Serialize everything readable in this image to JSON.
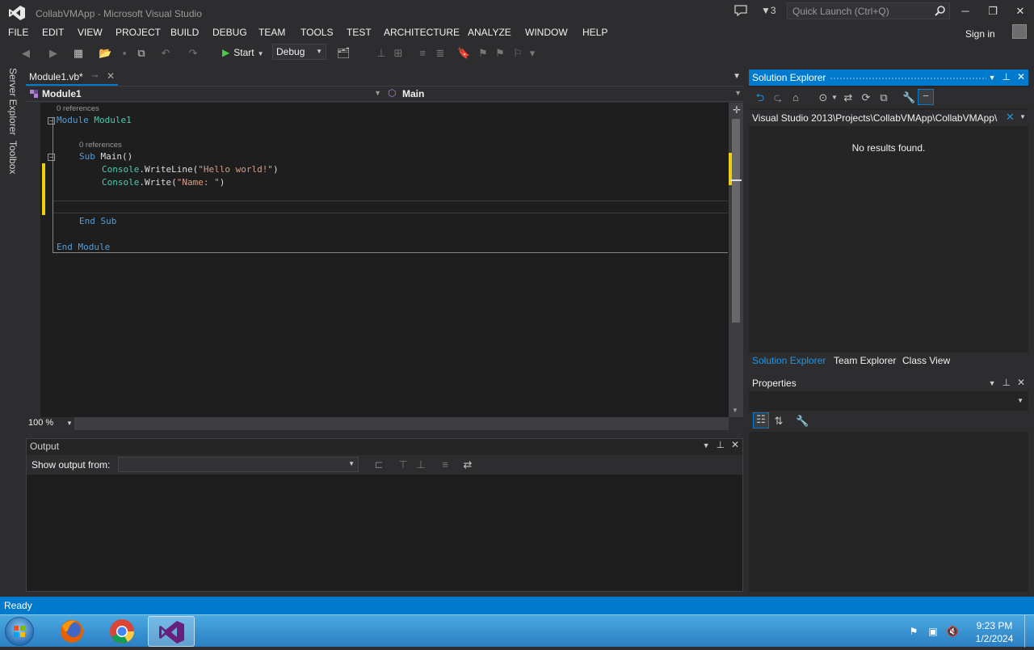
{
  "window": {
    "title": "CollabVMApp - Microsoft Visual Studio",
    "notifications": "3",
    "quick_launch_placeholder": "Quick Launch (Ctrl+Q)"
  },
  "menu": [
    "FILE",
    "EDIT",
    "VIEW",
    "PROJECT",
    "BUILD",
    "DEBUG",
    "TEAM",
    "TOOLS",
    "TEST",
    "ARCHITECTURE",
    "ANALYZE",
    "WINDOW",
    "HELP"
  ],
  "account": {
    "sign_in": "Sign in"
  },
  "toolbar": {
    "start_label": "Start",
    "configuration": "Debug"
  },
  "left_rail": {
    "tabs": [
      "Server Explorer",
      "Toolbox"
    ]
  },
  "editor": {
    "tab_label": "Module1.vb*",
    "nav_left": "Module1",
    "nav_right": "Main",
    "zoom": "100 %",
    "refs_module": "0 references",
    "refs_sub": "0 references",
    "lines": {
      "module_kw": "Module",
      "module_name": "Module1",
      "sub_kw": "Sub",
      "sub_name": "Main()",
      "l1_obj": "Console",
      "l1_call": ".WriteLine(",
      "l1_str": "\"Hello world!\"",
      "l1_end": ")",
      "l2_obj": "Console",
      "l2_call": ".Write(",
      "l2_str": "\"Name: \"",
      "l2_end": ")",
      "end_sub": "End Sub",
      "end_module": "End Module"
    }
  },
  "output": {
    "title": "Output",
    "show_output_from": "Show output from:",
    "source_value": ""
  },
  "solution_explorer": {
    "title": "Solution Explorer",
    "search_path": "Visual Studio 2013\\Projects\\CollabVMApp\\CollabVMApp\\",
    "results_text": "No results found.",
    "tabs": [
      "Solution Explorer",
      "Team Explorer",
      "Class View"
    ]
  },
  "properties": {
    "title": "Properties"
  },
  "status": {
    "text": "Ready"
  },
  "taskbar": {
    "apps": [
      "firefox-icon",
      "chrome-icon",
      "visual-studio-icon"
    ],
    "time": "9:23 PM",
    "date": "1/2/2024"
  },
  "colors": {
    "accent": "#007acc",
    "keyword": "#569cd6",
    "type": "#4ec9b0",
    "string": "#d69d85",
    "change_marker": "#efce0c"
  }
}
